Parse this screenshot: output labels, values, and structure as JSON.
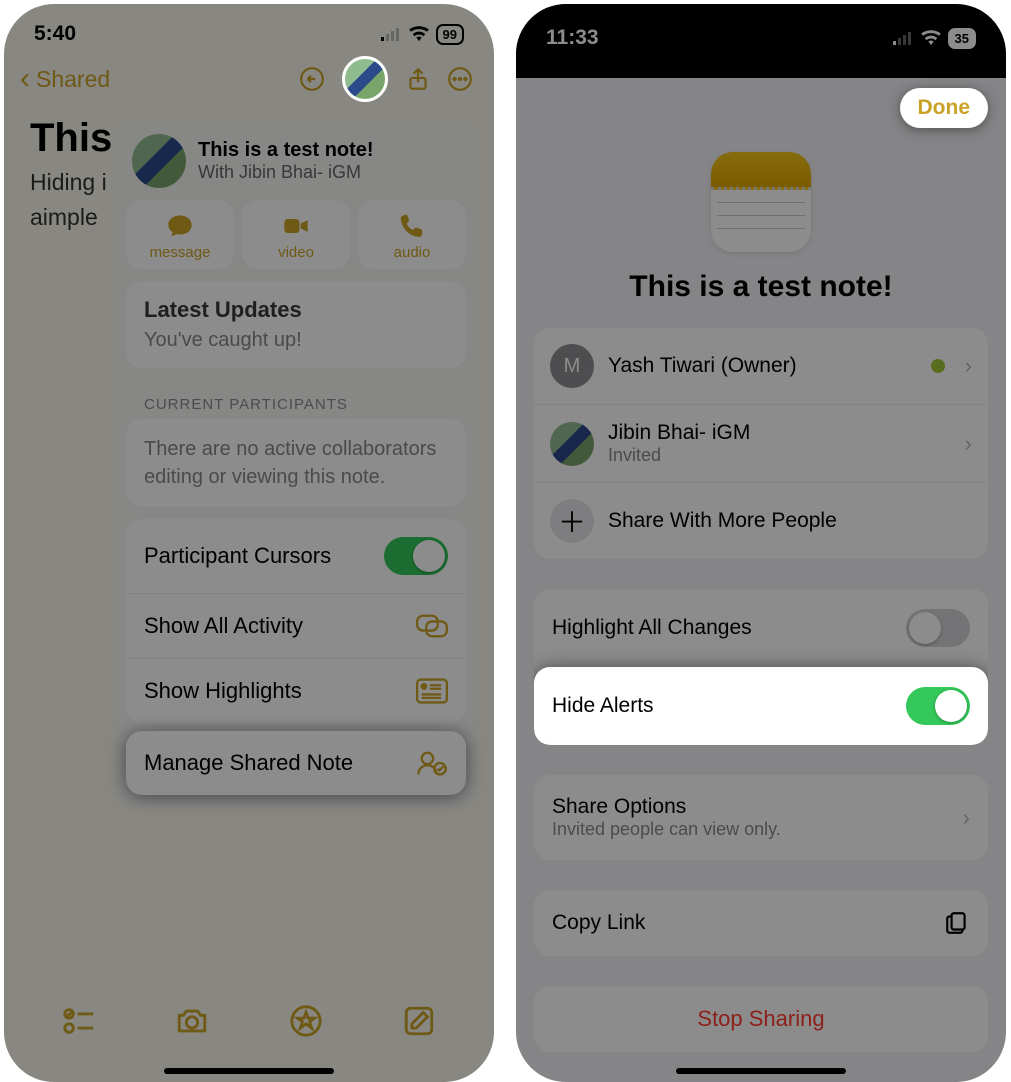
{
  "left": {
    "status": {
      "time": "5:40",
      "battery": "99"
    },
    "nav": {
      "back": "Shared"
    },
    "note": {
      "title": "This",
      "body_l1": "Hiding i",
      "body_l2": "aimple"
    },
    "popover": {
      "title": "This is a test note!",
      "subtitle": "With Jibin Bhai- iGM",
      "comm": {
        "message": "message",
        "video": "video",
        "audio": "audio"
      },
      "updates": {
        "title": "Latest Updates",
        "text": "You've caught up!"
      },
      "participants": {
        "label": "CURRENT PARTICIPANTS",
        "text": "There are no active collaborators editing or viewing this note."
      },
      "rows": {
        "cursors": "Participant Cursors",
        "activity": "Show All Activity",
        "highlights": "Show Highlights",
        "manage": "Manage Shared Note"
      }
    }
  },
  "right": {
    "status": {
      "time": "11:33",
      "battery": "35"
    },
    "done": "Done",
    "title": "This is a test note!",
    "people": {
      "owner": {
        "initial": "M",
        "name": "Yash Tiwari (Owner)"
      },
      "invitee": {
        "name": "Jibin Bhai- iGM",
        "status": "Invited"
      },
      "more": "Share With More People"
    },
    "settings": {
      "highlight_all": "Highlight All Changes",
      "hide_alerts": "Hide Alerts"
    },
    "share_options": {
      "title": "Share Options",
      "sub": "Invited people can view only."
    },
    "copy_link": "Copy Link",
    "stop_sharing": "Stop Sharing"
  }
}
